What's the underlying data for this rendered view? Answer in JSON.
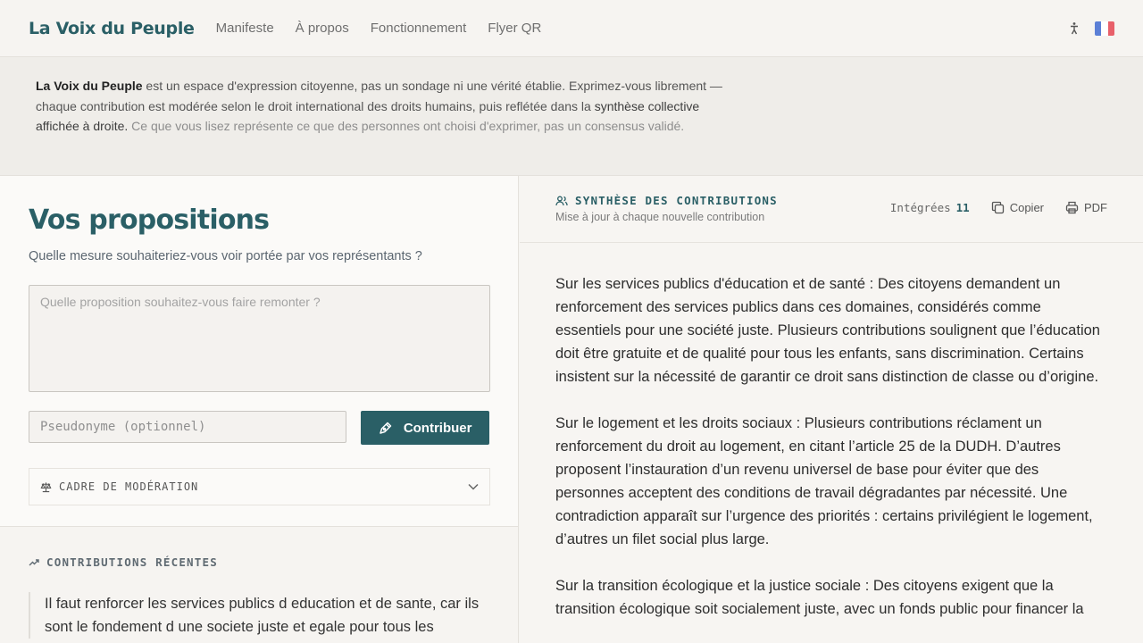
{
  "header": {
    "brand": "La Voix du Peuple",
    "nav": [
      "Manifeste",
      "À propos",
      "Fonctionnement",
      "Flyer QR"
    ],
    "flag_colors": [
      "#5b7fd6",
      "#ffffff",
      "#e8606a"
    ]
  },
  "disclaimer": {
    "brand": "La Voix du Peuple",
    "text_main": " est un espace d'expression citoyenne, pas un sondage ni une vérité établie. Exprimez-vous librement — chaque contribution est modérée selon le droit international des droits humains, puis reflétée dans la ",
    "text_dark": "synthèse collective affichée à droite.",
    "text_muted": " Ce que vous lisez représente ce que des personnes ont choisi d'exprimer, pas un consensus validé."
  },
  "compose": {
    "title": "Vos propositions",
    "subtitle": "Quelle mesure souhaiteriez-vous voir portée par vos représentants ?",
    "proposal_placeholder": "Quelle proposition souhaitez-vous faire remonter ?",
    "pseudonym_placeholder": "Pseudonyme (optionnel)",
    "submit_label": "Contribuer",
    "moderation_label": "CADRE DE MODÉRATION"
  },
  "recent": {
    "label": "CONTRIBUTIONS RÉCENTES",
    "items": [
      "Il faut renforcer les services publics d education et de sante, car ils sont le fondement d une societe juste et egale pour tous les"
    ]
  },
  "synthesis": {
    "title": "SYNTHÈSE DES CONTRIBUTIONS",
    "subtitle": "Mise à jour à chaque nouvelle contribution",
    "integrated_label": "Intégrées",
    "integrated_count": "11",
    "copy_label": "Copier",
    "pdf_label": "PDF",
    "paragraphs": [
      "Sur les services publics d'éducation et de santé : Des citoyens demandent un renforcement des services publics dans ces domaines, considérés comme essentiels pour une société juste. Plusieurs contributions soulignent que l’éducation doit être gratuite et de qualité pour tous les enfants, sans discrimination. Certains insistent sur la nécessité de garantir ce droit sans distinction de classe ou d’origine.",
      "Sur le logement et les droits sociaux : Plusieurs contributions réclament un renforcement du droit au logement, en citant l’article 25 de la DUDH. D’autres proposent l’instauration d’un revenu universel de base pour éviter que des personnes acceptent des conditions de travail dégradantes par nécessité. Une contradiction apparaît sur l’urgence des priorités : certains privilégient le logement, d’autres un filet social plus large.",
      "Sur la transition écologique et la justice sociale : Des citoyens exigent que la transition écologique soit socialement juste, avec un fonds public pour financer la"
    ]
  }
}
